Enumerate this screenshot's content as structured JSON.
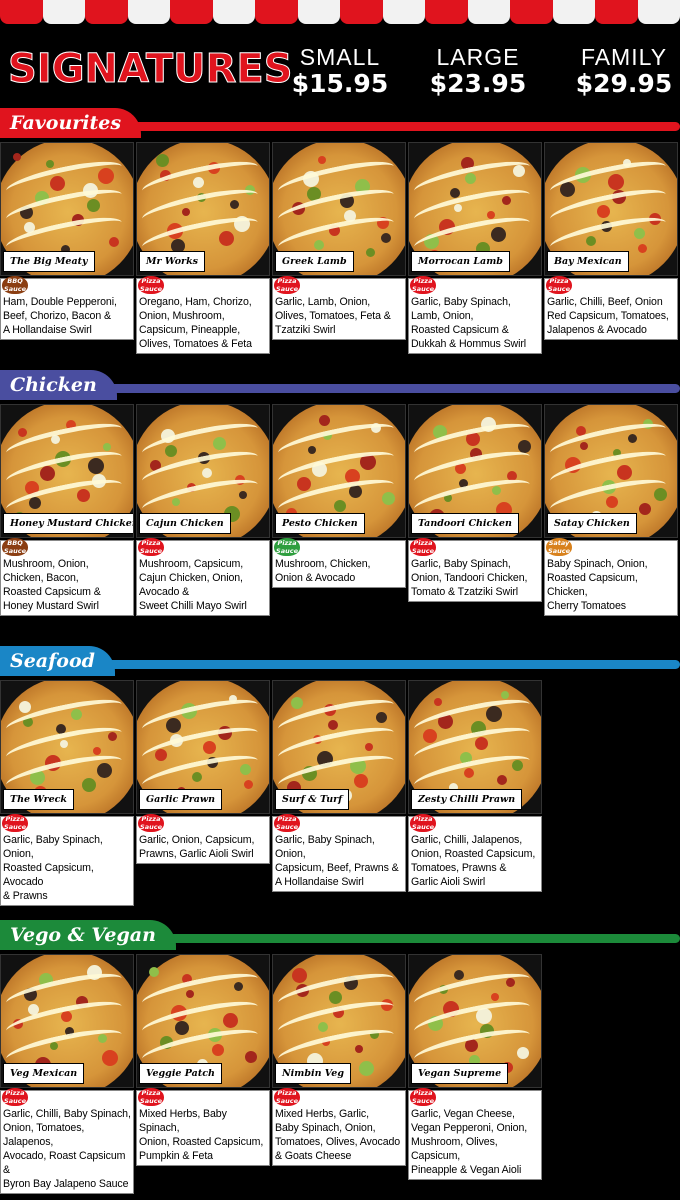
{
  "header": {
    "title": "SIGNATURES",
    "sizes": [
      {
        "name": "SMALL",
        "price": "$15.95"
      },
      {
        "name": "LARGE",
        "price": "$23.95"
      },
      {
        "name": "FAMILY",
        "price": "$29.95"
      }
    ]
  },
  "sections": [
    {
      "name": "Favourites",
      "color": "#e0141e",
      "items": [
        {
          "name": "The Big Meaty",
          "sauce": "BBQ Sauce",
          "sauce_color": "#8b3e12",
          "description": "Ham, Double Pepperoni,\nBeef, Chorizo, Bacon &\nA Hollandaise Swirl"
        },
        {
          "name": "Mr Works",
          "sauce": "Pizza Sauce",
          "sauce_color": "#e0141e",
          "description": "Oregano, Ham, Chorizo,\nOnion, Mushroom,\nCapsicum, Pineapple,\nOlives, Tomatoes & Feta"
        },
        {
          "name": "Greek Lamb",
          "sauce": "Pizza Sauce",
          "sauce_color": "#e0141e",
          "description": "Garlic, Lamb, Onion,\n Olives, Tomatoes, Feta &\nTzatziki Swirl"
        },
        {
          "name": "Morrocan Lamb",
          "sauce": "Pizza Sauce",
          "sauce_color": "#e0141e",
          "description": "Garlic, Baby Spinach,\nLamb, Onion,\nRoasted Capsicum &\nDukkah & Hommus Swirl"
        },
        {
          "name": "Bay Mexican",
          "sauce": "Pizza Sauce",
          "sauce_color": "#e0141e",
          "description": "Garlic, Chilli, Beef, Onion\nRed Capsicum, Tomatoes,\nJalapenos & Avocado"
        }
      ]
    },
    {
      "name": "Chicken",
      "color": "#4a4ea0",
      "items": [
        {
          "name": "Honey Mustard Chicken",
          "sauce": "BBQ Sauce",
          "sauce_color": "#8b3e12",
          "description": "Mushroom, Onion,\nChicken, Bacon,\nRoasted Capsicum &\nHoney Mustard Swirl"
        },
        {
          "name": "Cajun Chicken",
          "sauce": "Pizza Sauce",
          "sauce_color": "#e0141e",
          "description": "Mushroom, Capsicum,\nCajun Chicken, Onion,\nAvocado &\nSweet Chilli Mayo Swirl"
        },
        {
          "name": "Pesto Chicken",
          "sauce": "Pizza Sauce",
          "sauce_color": "#2e9e3e",
          "description": "Mushroom, Chicken,\nOnion & Avocado"
        },
        {
          "name": "Tandoori Chicken",
          "sauce": "Pizza Sauce",
          "sauce_color": "#e0141e",
          "description": "Garlic, Baby Spinach,\nOnion, Tandoori Chicken,\nTomato & Tzatziki Swirl"
        },
        {
          "name": "Satay Chicken",
          "sauce": "Satay Sauce",
          "sauce_color": "#d8811c",
          "description": "Baby Spinach, Onion,\nRoasted Capsicum, Chicken,\nCherry Tomatoes"
        }
      ]
    },
    {
      "name": "Seafood",
      "color": "#1a86c6",
      "items": [
        {
          "name": "The Wreck",
          "sauce": "Pizza Sauce",
          "sauce_color": "#e0141e",
          "description": "Garlic, Baby Spinach, Onion,\nRoasted Capsicum, Avocado\n& Prawns"
        },
        {
          "name": "Garlic Prawn",
          "sauce": "Pizza Sauce",
          "sauce_color": "#e0141e",
          "description": "Garlic, Onion, Capsicum,\nPrawns, Garlic Aioli Swirl"
        },
        {
          "name": "Surf & Turf",
          "sauce": "Pizza Sauce",
          "sauce_color": "#e0141e",
          "description": "Garlic, Baby Spinach,  Onion,\nCapsicum, Beef, Prawns &\nA Hollandaise Swirl"
        },
        {
          "name": "Zesty Chilli Prawn",
          "sauce": "Pizza Sauce",
          "sauce_color": "#e0141e",
          "description": "Garlic, Chilli, Jalapenos,\nOnion, Roasted Capsicum,\nTomatoes, Prawns &\nGarlic Aioli Swirl"
        }
      ]
    },
    {
      "name": "Vego & Vegan",
      "color": "#1c8a3a",
      "items": [
        {
          "name": "Veg Mexican",
          "sauce": "Pizza Sauce",
          "sauce_color": "#e0141e",
          "description": "Garlic, Chilli, Baby Spinach,\nOnion, Tomatoes, Jalapenos,\nAvocado, Roast Capsicum &\nByron Bay Jalapeno Sauce"
        },
        {
          "name": "Veggie Patch",
          "sauce": "Pizza Sauce",
          "sauce_color": "#e0141e",
          "description": "Mixed Herbs, Baby Spinach,\nOnion, Roasted Capsicum,\nPumpkin & Feta"
        },
        {
          "name": "Nimbin Veg",
          "sauce": "Pizza Sauce",
          "sauce_color": "#e0141e",
          "description": "Mixed Herbs, Garlic,\nBaby Spinach, Onion,\nTomatoes, Olives, Avocado\n& Goats Cheese"
        },
        {
          "name": "Vegan Supreme",
          "sauce": "Pizza Sauce",
          "sauce_color": "#e0141e",
          "description": "Garlic, Vegan Cheese,\nVegan Pepperoni, Onion,\nMushroom, Olives, Capsicum,\nPineapple & Vegan Aioli"
        }
      ]
    }
  ]
}
